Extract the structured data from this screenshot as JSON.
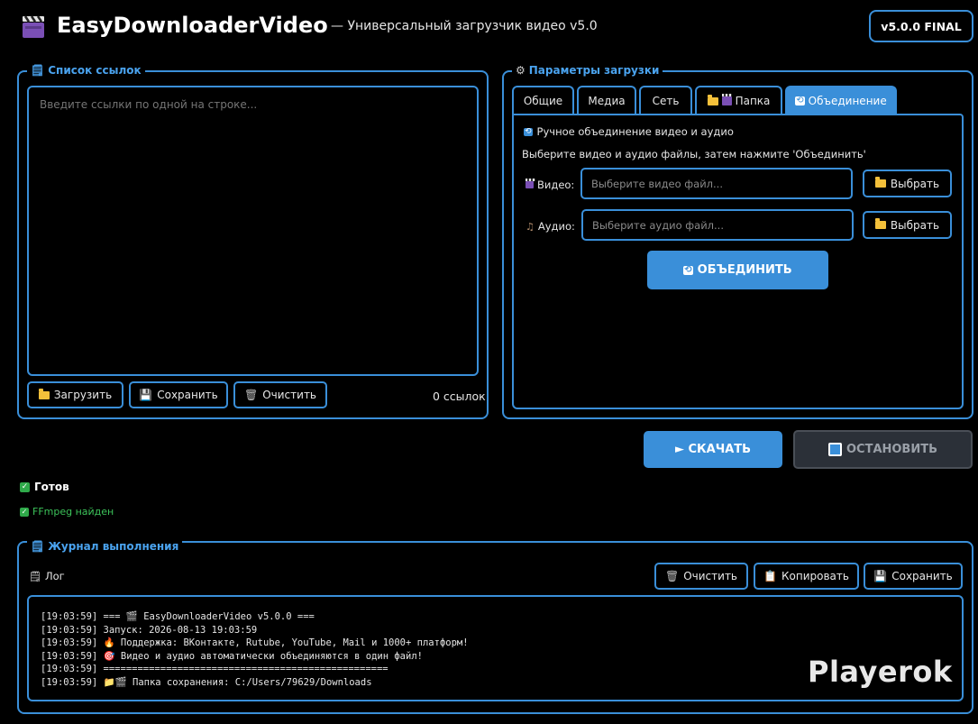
{
  "header": {
    "app_name": "EasyDownloaderVideo",
    "subtitle": "— Универсальный загрузчик видео v5.0",
    "version_badge": "v5.0.0 FINAL"
  },
  "links_panel": {
    "title": "Список ссылок",
    "placeholder": "Введите ссылки по одной на строке...",
    "load_label": "Загрузить",
    "save_label": "Сохранить",
    "clear_label": "Очистить",
    "count_label": "0 ссылок"
  },
  "params_panel": {
    "title": "Параметры загрузки",
    "tabs": [
      "Общие",
      "Медиа",
      "Сеть",
      "Папка",
      "Объединение"
    ],
    "active_tab": "Объединение",
    "merge": {
      "heading": "Ручное объединение видео и аудио",
      "hint": "Выберите видео и аудио файлы, затем нажмите 'Объединить'",
      "video_label": "Видео:",
      "video_placeholder": "Выберите видео файл...",
      "audio_label": "Аудио:",
      "audio_placeholder": "Выберите аудио файл...",
      "choose_label": "Выбрать",
      "merge_button": "ОБЪЕДИНИТЬ"
    }
  },
  "actions": {
    "download_label": "► СКАЧАТЬ",
    "stop_label": "ОСТАНОВИТЬ"
  },
  "status": {
    "main": "Готов",
    "ffmpeg": "FFmpeg найден"
  },
  "log_panel": {
    "title": "Журнал выполнения",
    "label": "Лог",
    "clear_label": "Очистить",
    "copy_label": "Копировать",
    "save_label": "Сохранить",
    "lines": [
      "[19:03:59] === 🎬 EasyDownloaderVideo v5.0.0 ===",
      "[19:03:59] Запуск: 2026-08-13 19:03:59",
      "[19:03:59] 🔥 Поддержка: ВКонтакте, Rutube, YouTube, Mail и 1000+ платформ!",
      "[19:03:59] 🎯 Видео и аудио автоматически объединяются в один файл!",
      "[19:03:59] ==================================================",
      "[19:03:59] 📁🎬 Папка сохранения: C:/Users/79629/Downloads"
    ]
  },
  "watermark": "Playerok",
  "colors": {
    "accent": "#3a8fd9",
    "legend_text": "#4aa3ef",
    "success": "#2faa4a",
    "stop_bg": "#2b3038"
  }
}
